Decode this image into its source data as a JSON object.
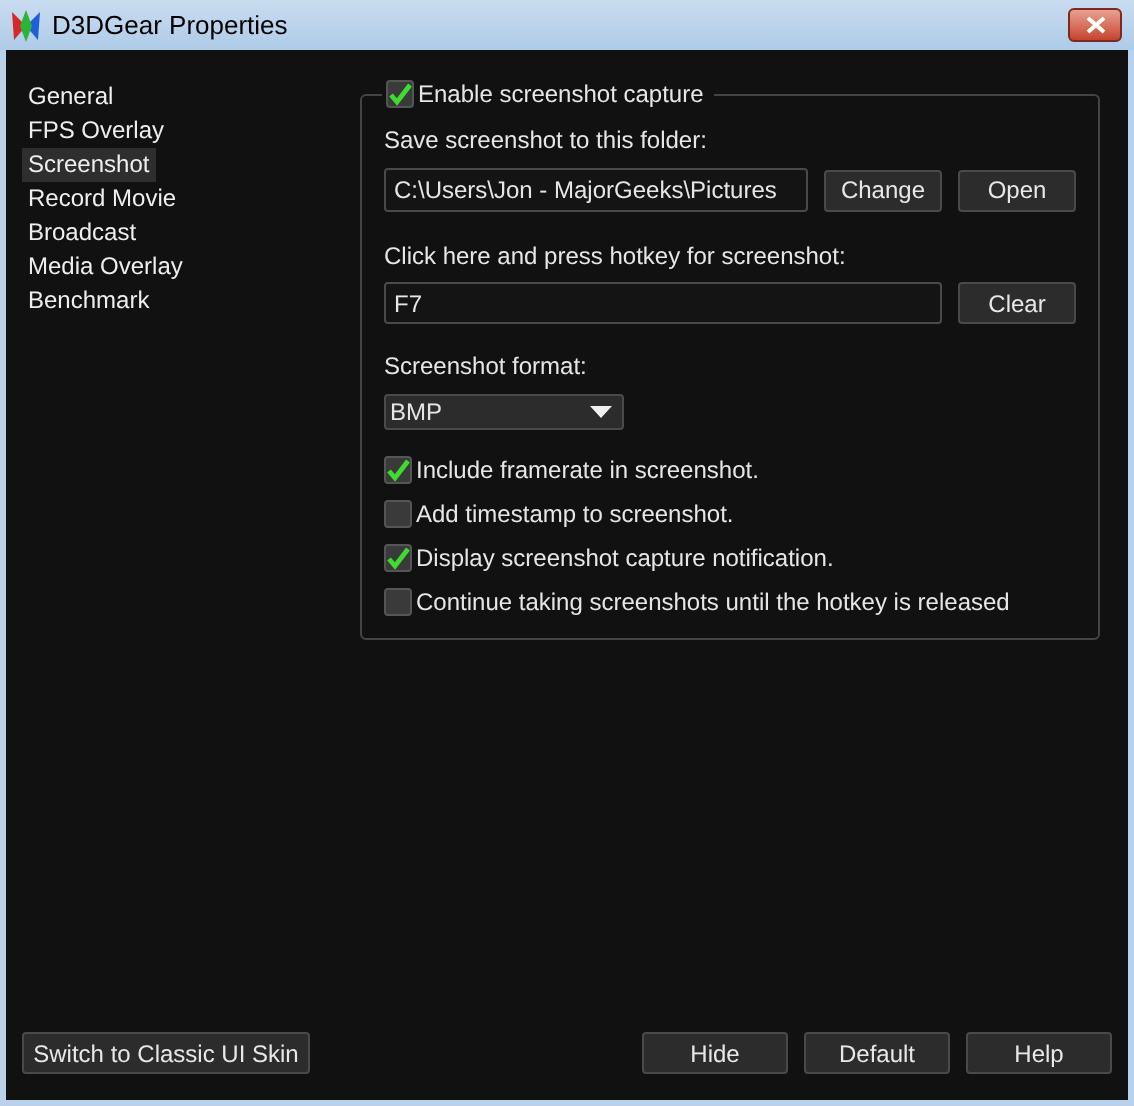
{
  "window": {
    "title": "D3DGear Properties"
  },
  "sidebar": {
    "items": [
      {
        "label": "General",
        "selected": false
      },
      {
        "label": "FPS Overlay",
        "selected": false
      },
      {
        "label": "Screenshot",
        "selected": true
      },
      {
        "label": "Record Movie",
        "selected": false
      },
      {
        "label": "Broadcast",
        "selected": false
      },
      {
        "label": "Media Overlay",
        "selected": false
      },
      {
        "label": "Benchmark",
        "selected": false
      }
    ]
  },
  "screenshot": {
    "enable": {
      "label": "Enable screenshot capture",
      "checked": true
    },
    "folder_label": "Save screenshot to this folder:",
    "folder_path": "C:\\Users\\Jon - MajorGeeks\\Pictures",
    "folder_buttons": [
      "Change",
      "Open"
    ],
    "hotkey_label": "Click here and press hotkey for screenshot:",
    "hotkey": "F7",
    "hotkey_button": "Clear",
    "format_label": "Screenshot format:",
    "format": "BMP",
    "options": [
      {
        "label": "Include framerate in screenshot.",
        "checked": true
      },
      {
        "label": "Add timestamp to screenshot.",
        "checked": false
      },
      {
        "label": "Display screenshot capture notification.",
        "checked": true
      },
      {
        "label": "Continue taking screenshots until the hotkey is released",
        "checked": false
      }
    ]
  },
  "footer": {
    "skin_button": "Switch to Classic UI Skin",
    "buttons": [
      "Hide",
      "Default",
      "Help"
    ]
  }
}
